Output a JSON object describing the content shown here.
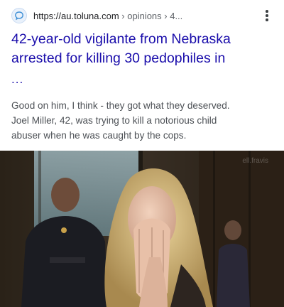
{
  "result": {
    "url": "https://au.toluna.com",
    "breadcrumb": " › opinions › 4...",
    "headline": "42-year-old vigilante from Nebraska\narrested for killing 30 pedophiles in",
    "headline_ellipsis": "...",
    "snippet": "Good on him, I think - they got what they deserved.\nJoel Miller, 42, was trying to kill a notorious child\nabuser when he was caught by the cops."
  },
  "icons": {
    "favicon": "toluna-speech-bubble-icon",
    "menu": "more-vert-icon"
  },
  "video": {
    "description_icon": "video-still",
    "watermark": "ell.fravis"
  },
  "colors": {
    "link": "#1a0dab",
    "snippet_text": "#4d5156",
    "favicon_accent": "#3d8fd6"
  }
}
